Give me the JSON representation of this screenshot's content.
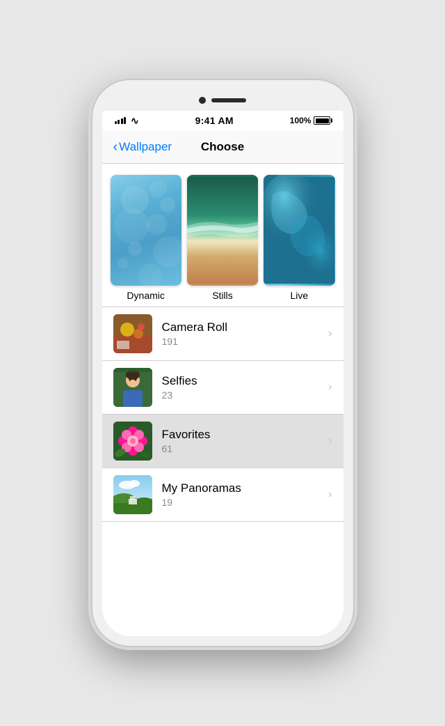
{
  "phone": {
    "status_bar": {
      "time": "9:41 AM",
      "battery_percent": "100%"
    },
    "nav": {
      "back_label": "Wallpaper",
      "title": "Choose"
    },
    "wallpaper_section": {
      "items": [
        {
          "id": "dynamic",
          "label": "Dynamic"
        },
        {
          "id": "stills",
          "label": "Stills"
        },
        {
          "id": "live",
          "label": "Live"
        }
      ]
    },
    "albums": [
      {
        "name": "Camera Roll",
        "count": "191",
        "highlighted": false
      },
      {
        "name": "Selfies",
        "count": "23",
        "highlighted": false
      },
      {
        "name": "Favorites",
        "count": "61",
        "highlighted": true
      },
      {
        "name": "My Panoramas",
        "count": "19",
        "highlighted": false
      }
    ]
  }
}
